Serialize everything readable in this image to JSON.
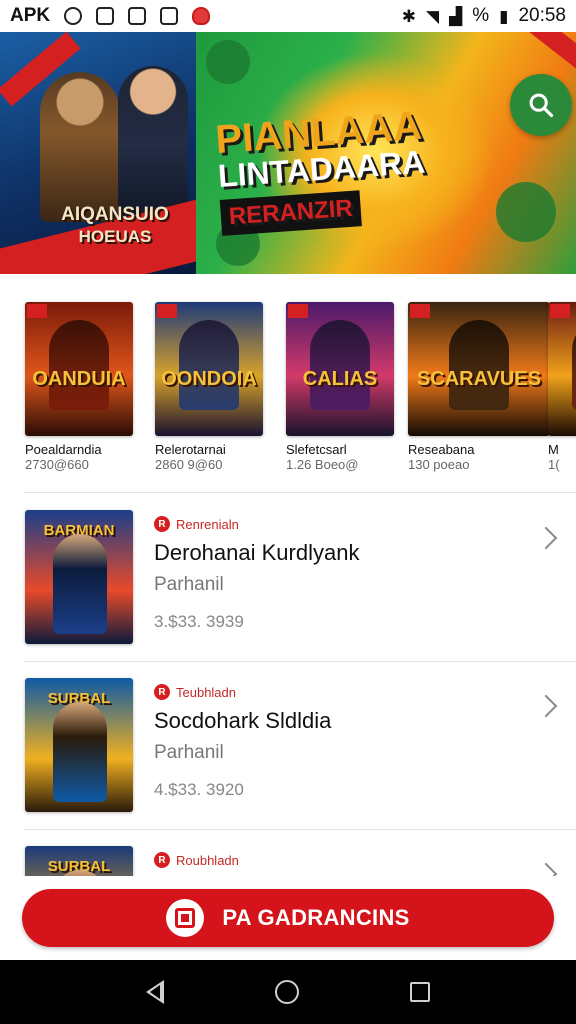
{
  "status_bar": {
    "app_label": "APK",
    "battery": "%",
    "time": "20:58"
  },
  "hero": {
    "left_badge": "",
    "left_title": "AIQANSUIO",
    "left_subtitle": "HOEUAS",
    "title_line1": "PIANLAAA",
    "title_line2": "LINTADAARA",
    "title_line3": "RERANZIR",
    "search_icon": "search-icon"
  },
  "shelf": {
    "items": [
      {
        "title": "Poealdarndia",
        "subtitle": "2730@660",
        "cover_word": "OANDUIA",
        "cover_colors": [
          "#7a1a0a",
          "#e0561a",
          "#2a0c04"
        ]
      },
      {
        "title": "Relerotarnai",
        "subtitle": "2860 9@60",
        "cover_word": "OONDOIA",
        "cover_colors": [
          "#1d3a7a",
          "#d8a22a",
          "#1a1230"
        ]
      },
      {
        "title": "Slefetcsarl",
        "subtitle": "1.26 Boeo@",
        "cover_word": "CALIAS",
        "cover_colors": [
          "#4a1a6a",
          "#d23a6a",
          "#16122a"
        ]
      },
      {
        "title": "Reseabana",
        "subtitle": "130 poeao",
        "cover_word": "SCARAVUES",
        "cover_colors": [
          "#3a2410",
          "#f07a1a",
          "#120a04"
        ]
      },
      {
        "title": "M",
        "subtitle": "1(",
        "cover_word": "",
        "cover_colors": [
          "#6a1a12",
          "#f2a21a",
          "#1a0a04"
        ]
      }
    ]
  },
  "list": {
    "items": [
      {
        "tag": "Renrenialn",
        "title": "Derohanai Kurdlyank",
        "subtitle": "Parhanil",
        "meta": "3.$33. 3939",
        "thumb_word": "BARMIAN",
        "thumb_colors": [
          "#1b3f8a",
          "#e84a2a",
          "#0c1b3c"
        ]
      },
      {
        "tag": "Teubhladn",
        "title": "Socdohark Sldldia",
        "subtitle": "Parhanil",
        "meta": "4.$33. 3920",
        "thumb_word": "SURBAL",
        "thumb_colors": [
          "#0e5aa6",
          "#f0b020",
          "#2a1a0a"
        ]
      },
      {
        "tag": "Roubhladn",
        "title": "",
        "subtitle": "",
        "meta": "",
        "thumb_word": "SURBAL",
        "thumb_colors": [
          "#1a3a7a",
          "#e0a020",
          "#2a1a0a"
        ]
      }
    ]
  },
  "cta": {
    "label": "PA GADRANCINS",
    "icon": "store-icon"
  },
  "nav": {
    "back_icon": "back-icon",
    "home_icon": "home-icon",
    "recents_icon": "recents-icon"
  },
  "colors": {
    "brand_red": "#d4141a",
    "hero_green": "#2a8a3a",
    "tag_red": "#c62828"
  }
}
